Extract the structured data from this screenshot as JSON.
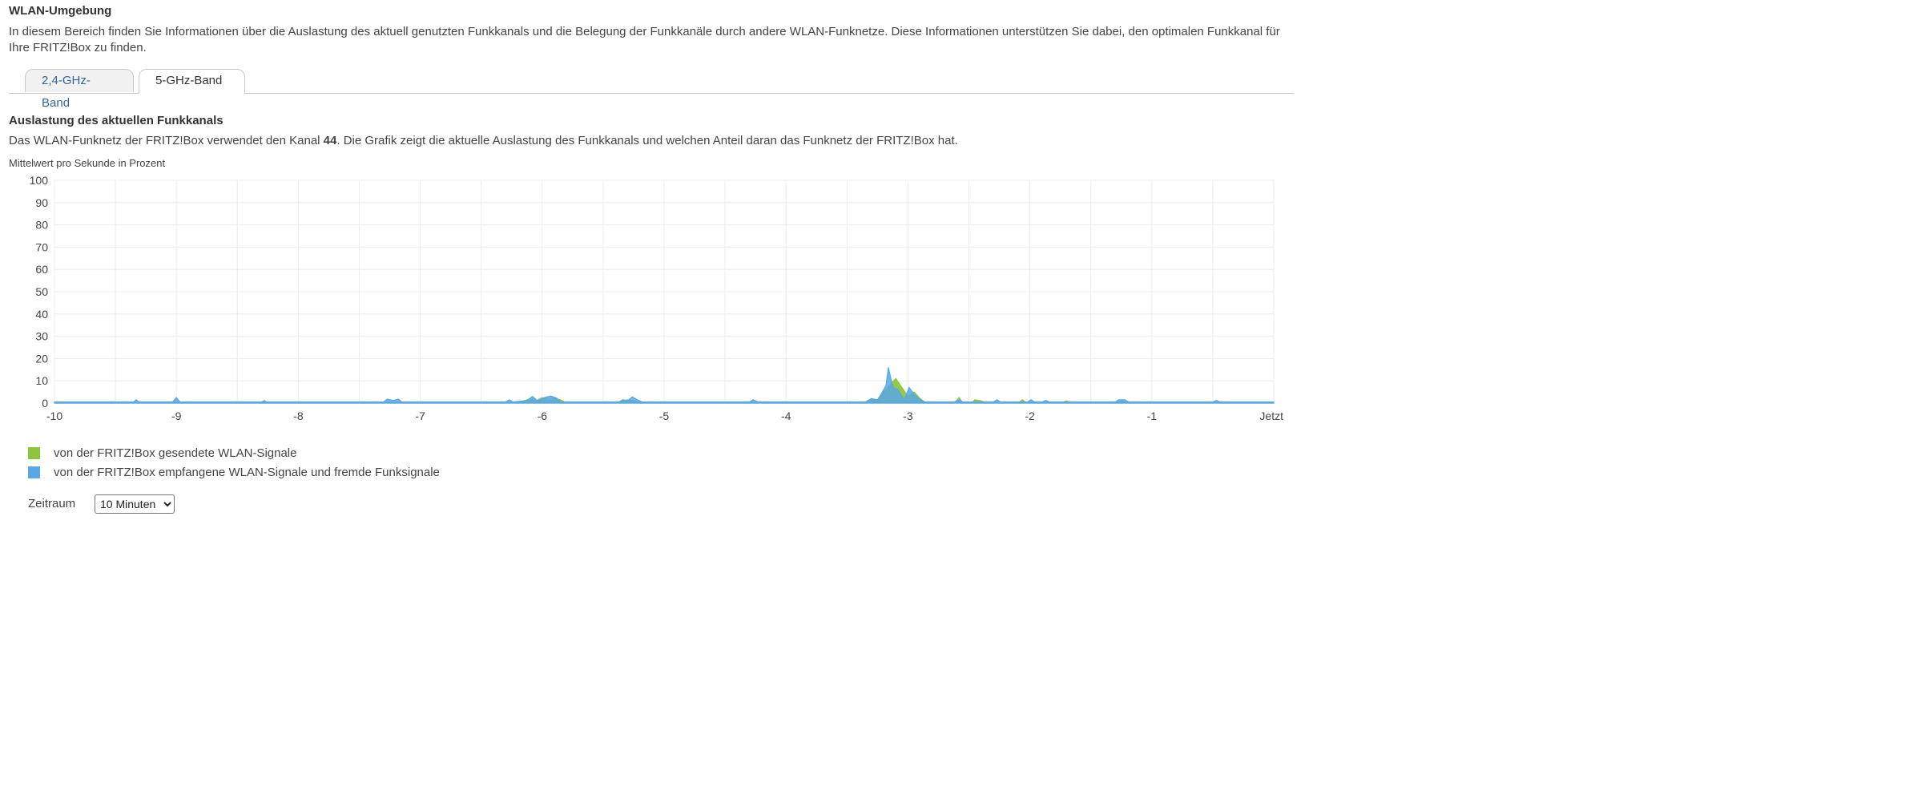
{
  "page": {
    "title": "WLAN-Umgebung",
    "intro": "In diesem Bereich finden Sie Informationen über die Auslastung des aktuell genutzten Funkkanals und die Belegung der Funkkanäle durch andere WLAN-Funknetze. Diese Informationen unterstützen Sie dabei, den optimalen Funkkanal für Ihre FRITZ!Box zu finden."
  },
  "tabs": [
    {
      "label": "2,4-GHz-Band",
      "active": false
    },
    {
      "label": "5-GHz-Band",
      "active": true
    }
  ],
  "section": {
    "title": "Auslastung des aktuellen Funkkanals",
    "desc_before": "Das WLAN-Funknetz der FRITZ!Box verwendet den Kanal ",
    "channel": "44",
    "desc_after": ". Die Grafik zeigt die aktuelle Auslastung des Funkkanals und welchen Anteil daran das Funknetz der FRITZ!Box hat.",
    "unit_label": "Mittelwert pro Sekunde in Prozent"
  },
  "chart_data": {
    "type": "area",
    "ylim": [
      0,
      100
    ],
    "yticks": [
      "0",
      "10",
      "20",
      "30",
      "40",
      "50",
      "60",
      "70",
      "80",
      "90",
      "100"
    ],
    "xlim": [
      -10,
      0
    ],
    "xticks": [
      {
        "value": -10,
        "label": "-10"
      },
      {
        "value": -9,
        "label": "-9"
      },
      {
        "value": -8,
        "label": "-8"
      },
      {
        "value": -7,
        "label": "-7"
      },
      {
        "value": -6,
        "label": "-6"
      },
      {
        "value": -5,
        "label": "-5"
      },
      {
        "value": -4,
        "label": "-4"
      },
      {
        "value": -3,
        "label": "-3"
      },
      {
        "value": -2,
        "label": "-2"
      },
      {
        "value": -1,
        "label": "-1"
      },
      {
        "value": 0,
        "label": "Jetzt"
      }
    ],
    "grid": true,
    "series": [
      {
        "name": "von der FRITZ!Box gesendete WLAN-Signale",
        "color": "#8cc63f",
        "points": [
          [
            -10,
            0
          ],
          [
            -6.2,
            0
          ],
          [
            -6.15,
            1
          ],
          [
            -6.1,
            2
          ],
          [
            -6.05,
            1
          ],
          [
            -6.0,
            2.5
          ],
          [
            -5.95,
            1.5
          ],
          [
            -5.9,
            2
          ],
          [
            -5.85,
            1.5
          ],
          [
            -5.8,
            0
          ],
          [
            -5.4,
            0
          ],
          [
            -5.35,
            1
          ],
          [
            -5.3,
            1.5
          ],
          [
            -5.25,
            1
          ],
          [
            -5.2,
            0
          ],
          [
            -3.35,
            0
          ],
          [
            -3.3,
            2
          ],
          [
            -3.25,
            1
          ],
          [
            -3.2,
            5
          ],
          [
            -3.15,
            8
          ],
          [
            -3.1,
            11
          ],
          [
            -3.05,
            7
          ],
          [
            -3.0,
            3
          ],
          [
            -2.95,
            5
          ],
          [
            -2.9,
            2
          ],
          [
            -2.85,
            0
          ],
          [
            -2.62,
            0
          ],
          [
            -2.58,
            2.5
          ],
          [
            -2.55,
            0
          ],
          [
            -2.48,
            0
          ],
          [
            -2.45,
            1.5
          ],
          [
            -2.4,
            1
          ],
          [
            -2.35,
            0
          ],
          [
            -2.1,
            0
          ],
          [
            -2.06,
            1.5
          ],
          [
            -2.03,
            0
          ],
          [
            -1.75,
            0
          ],
          [
            -1.7,
            1
          ],
          [
            -1.66,
            0
          ],
          [
            -1.3,
            0
          ],
          [
            -1.25,
            1
          ],
          [
            -1.2,
            0
          ],
          [
            0,
            0
          ]
        ]
      },
      {
        "name": "von der FRITZ!Box empfangene WLAN-Signale und fremde Funksignale",
        "color": "#5aa7e4",
        "points": [
          [
            -10,
            0.5
          ],
          [
            -9.35,
            0.5
          ],
          [
            -9.33,
            1.5
          ],
          [
            -9.31,
            0.5
          ],
          [
            -9.03,
            0.5
          ],
          [
            -9.0,
            2.5
          ],
          [
            -8.97,
            0.5
          ],
          [
            -8.3,
            0.5
          ],
          [
            -8.28,
            1.2
          ],
          [
            -8.26,
            0.5
          ],
          [
            -7.3,
            0.5
          ],
          [
            -7.27,
            1.8
          ],
          [
            -7.22,
            1.2
          ],
          [
            -7.18,
            1.8
          ],
          [
            -7.15,
            0.5
          ],
          [
            -6.3,
            0.5
          ],
          [
            -6.27,
            1.5
          ],
          [
            -6.24,
            0.5
          ],
          [
            -6.12,
            1.2
          ],
          [
            -6.08,
            3
          ],
          [
            -6.04,
            1.2
          ],
          [
            -5.98,
            2.5
          ],
          [
            -5.93,
            3.2
          ],
          [
            -5.88,
            2.2
          ],
          [
            -5.85,
            0.5
          ],
          [
            -5.37,
            0.5
          ],
          [
            -5.34,
            1.5
          ],
          [
            -5.3,
            1
          ],
          [
            -5.26,
            2.8
          ],
          [
            -5.22,
            1.5
          ],
          [
            -5.18,
            0.5
          ],
          [
            -4.3,
            0.5
          ],
          [
            -4.27,
            1.5
          ],
          [
            -4.23,
            0.5
          ],
          [
            -3.35,
            0.5
          ],
          [
            -3.3,
            2
          ],
          [
            -3.25,
            1.5
          ],
          [
            -3.22,
            4
          ],
          [
            -3.18,
            8
          ],
          [
            -3.16,
            16
          ],
          [
            -3.14,
            11
          ],
          [
            -3.12,
            7
          ],
          [
            -3.08,
            6
          ],
          [
            -3.03,
            1.5
          ],
          [
            -2.99,
            7
          ],
          [
            -2.95,
            4
          ],
          [
            -2.9,
            1.5
          ],
          [
            -2.86,
            0.5
          ],
          [
            -2.62,
            0.5
          ],
          [
            -2.58,
            1.5
          ],
          [
            -2.55,
            0.5
          ],
          [
            -2.3,
            0.5
          ],
          [
            -2.27,
            1.5
          ],
          [
            -2.24,
            0.5
          ],
          [
            -2.02,
            0.5
          ],
          [
            -1.99,
            1.5
          ],
          [
            -1.96,
            0.5
          ],
          [
            -1.9,
            0.5
          ],
          [
            -1.87,
            1.2
          ],
          [
            -1.84,
            0.5
          ],
          [
            -1.3,
            0.5
          ],
          [
            -1.27,
            1.5
          ],
          [
            -1.22,
            1.5
          ],
          [
            -1.19,
            0.5
          ],
          [
            -0.5,
            0.5
          ],
          [
            -0.47,
            1.2
          ],
          [
            -0.44,
            0.5
          ],
          [
            0,
            0.5
          ]
        ]
      }
    ]
  },
  "legend": [
    {
      "label": "von der FRITZ!Box gesendete WLAN-Signale",
      "color": "#8cc63f"
    },
    {
      "label": "von der FRITZ!Box empfangene WLAN-Signale und fremde Funksignale",
      "color": "#5aa7e4"
    }
  ],
  "zeitraum": {
    "label": "Zeitraum",
    "selected": "10 Minuten"
  }
}
